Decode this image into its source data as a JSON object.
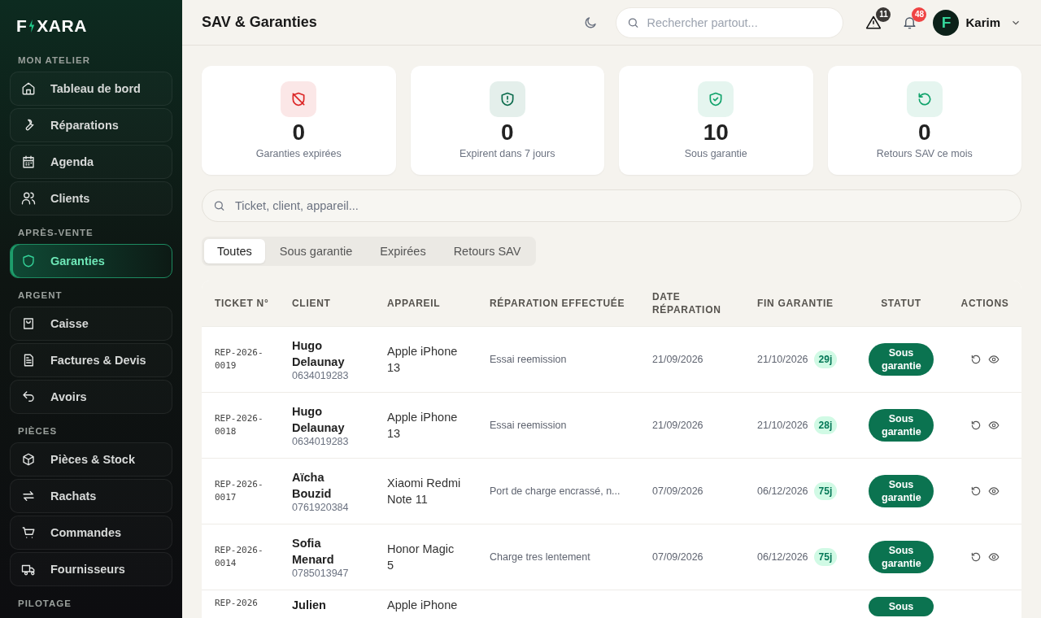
{
  "logo": {
    "start": "F",
    "end": "XARA"
  },
  "sidebar": {
    "sections": [
      {
        "title": "MON ATELIER",
        "items": [
          {
            "label": "Tableau de bord",
            "selected": false
          },
          {
            "label": "Réparations",
            "selected": false
          },
          {
            "label": "Agenda",
            "selected": false
          },
          {
            "label": "Clients",
            "selected": false
          }
        ]
      },
      {
        "title": "APRÈS-VENTE",
        "items": [
          {
            "label": "Garanties",
            "selected": true
          }
        ]
      },
      {
        "title": "ARGENT",
        "items": [
          {
            "label": "Caisse",
            "selected": false
          },
          {
            "label": "Factures & Devis",
            "selected": false
          },
          {
            "label": "Avoirs",
            "selected": false
          }
        ]
      },
      {
        "title": "PIÈCES",
        "items": [
          {
            "label": "Pièces & Stock",
            "selected": false
          },
          {
            "label": "Rachats",
            "selected": false
          },
          {
            "label": "Commandes",
            "selected": false
          },
          {
            "label": "Fournisseurs",
            "selected": false
          }
        ]
      },
      {
        "title": "PILOTAGE"
      }
    ]
  },
  "header": {
    "title": "SAV & Garanties",
    "search": {
      "placeholder": "Rechercher partout..."
    },
    "alerts_count": "11",
    "notifications_count": "48",
    "user": {
      "initial": "F",
      "name": "Karim"
    }
  },
  "stats": [
    {
      "value": "0",
      "label": "Garanties expirées",
      "color": "#dc2626"
    },
    {
      "value": "0",
      "label": "Expirent dans 7 jours",
      "color": "#0b6b4c"
    },
    {
      "value": "10",
      "label": "Sous garantie",
      "color": "#10a36b"
    },
    {
      "value": "0",
      "label": "Retours SAV ce mois",
      "color": "#10a36b"
    }
  ],
  "filter_search": {
    "placeholder": "Ticket, client, appareil..."
  },
  "tabs": [
    {
      "label": "Toutes",
      "selected": true
    },
    {
      "label": "Sous garantie",
      "selected": false
    },
    {
      "label": "Expirées",
      "selected": false
    },
    {
      "label": "Retours SAV",
      "selected": false
    }
  ],
  "table": {
    "columns": [
      "TICKET N°",
      "CLIENT",
      "APPAREIL",
      "RÉPARATION EFFECTUÉE",
      "DATE RÉPARATION",
      "FIN GARANTIE",
      "STATUT",
      "ACTIONS"
    ],
    "rows": [
      {
        "ticket": "REP-2026-0019",
        "client": "Hugo Delaunay",
        "phone": "0634019283",
        "device": "Apple iPhone 13",
        "repair": "Essai reemission",
        "date": "21/09/2026",
        "end": "21/10/2026",
        "days": "29j",
        "status": "Sous garantie"
      },
      {
        "ticket": "REP-2026-0018",
        "client": "Hugo Delaunay",
        "phone": "0634019283",
        "device": "Apple iPhone 13",
        "repair": "Essai reemission",
        "date": "21/09/2026",
        "end": "21/10/2026",
        "days": "28j",
        "status": "Sous garantie"
      },
      {
        "ticket": "REP-2026-0017",
        "client": "Aïcha Bouzid",
        "phone": "0761920384",
        "device": "Xiaomi Redmi Note 11",
        "repair": "Port de charge encrassé, n...",
        "date": "07/09/2026",
        "end": "06/12/2026",
        "days": "75j",
        "status": "Sous garantie"
      },
      {
        "ticket": "REP-2026-0014",
        "client": "Sofia Menard",
        "phone": "0785013947",
        "device": "Honor Magic 5",
        "repair": "Charge tres lentement",
        "date": "07/09/2026",
        "end": "06/12/2026",
        "days": "75j",
        "status": "Sous garantie"
      },
      {
        "ticket": "REP-2026",
        "client": "Julien",
        "device": "Apple iPhone",
        "status": "Sous"
      }
    ]
  }
}
